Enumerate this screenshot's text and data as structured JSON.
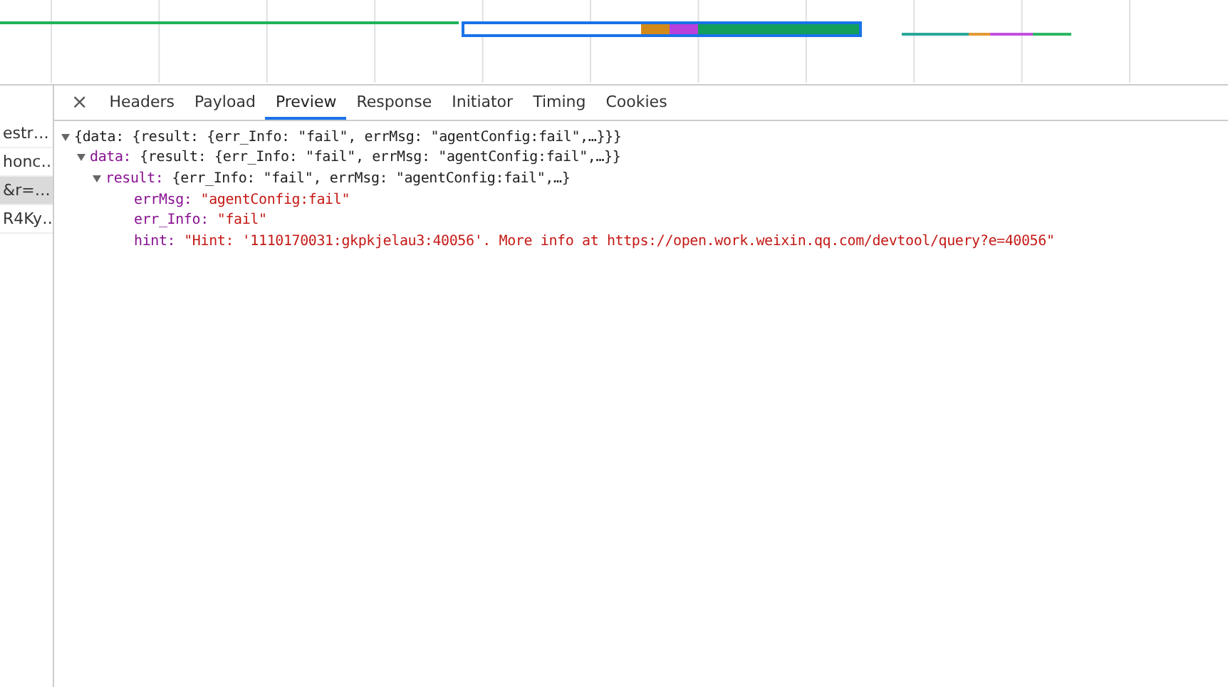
{
  "request_list": [
    {
      "name": "estr…",
      "selected": false
    },
    {
      "name": "honc…",
      "selected": false
    },
    {
      "name": "&r=…",
      "selected": true
    },
    {
      "name": "R4Ky…",
      "selected": false
    }
  ],
  "close_label": "×",
  "tabs": [
    {
      "label": "Headers",
      "selected": false
    },
    {
      "label": "Payload",
      "selected": false
    },
    {
      "label": "Preview",
      "selected": true
    },
    {
      "label": "Response",
      "selected": false
    },
    {
      "label": "Initiator",
      "selected": false
    },
    {
      "label": "Timing",
      "selected": false
    },
    {
      "label": "Cookies",
      "selected": false
    }
  ],
  "preview": [
    {
      "summary": "{data: {result: {err_Info: \"fail\", errMsg: \"agentConfig:fail\",…}}}",
      "expanded": true,
      "children": [
        {
          "key": "data:",
          "summary": "{result: {err_Info: \"fail\", errMsg: \"agentConfig:fail\",…}}",
          "expanded": true,
          "children": [
            {
              "key": "result:",
              "summary": "{err_Info: \"fail\", errMsg: \"agentConfig:fail\",…}",
              "expanded": true,
              "children": [
                {
                  "key": "errMsg:",
                  "value": "\"agentConfig:fail\""
                },
                {
                  "key": "err_Info:",
                  "value": "\"fail\""
                },
                {
                  "key": "hint:",
                  "value": "\"Hint: '1110170031:gkpkjelau3:40056'. More info at https://open.work.weixin.qq.com/devtool/query?e=40056\""
                }
              ]
            }
          ]
        }
      ]
    }
  ]
}
